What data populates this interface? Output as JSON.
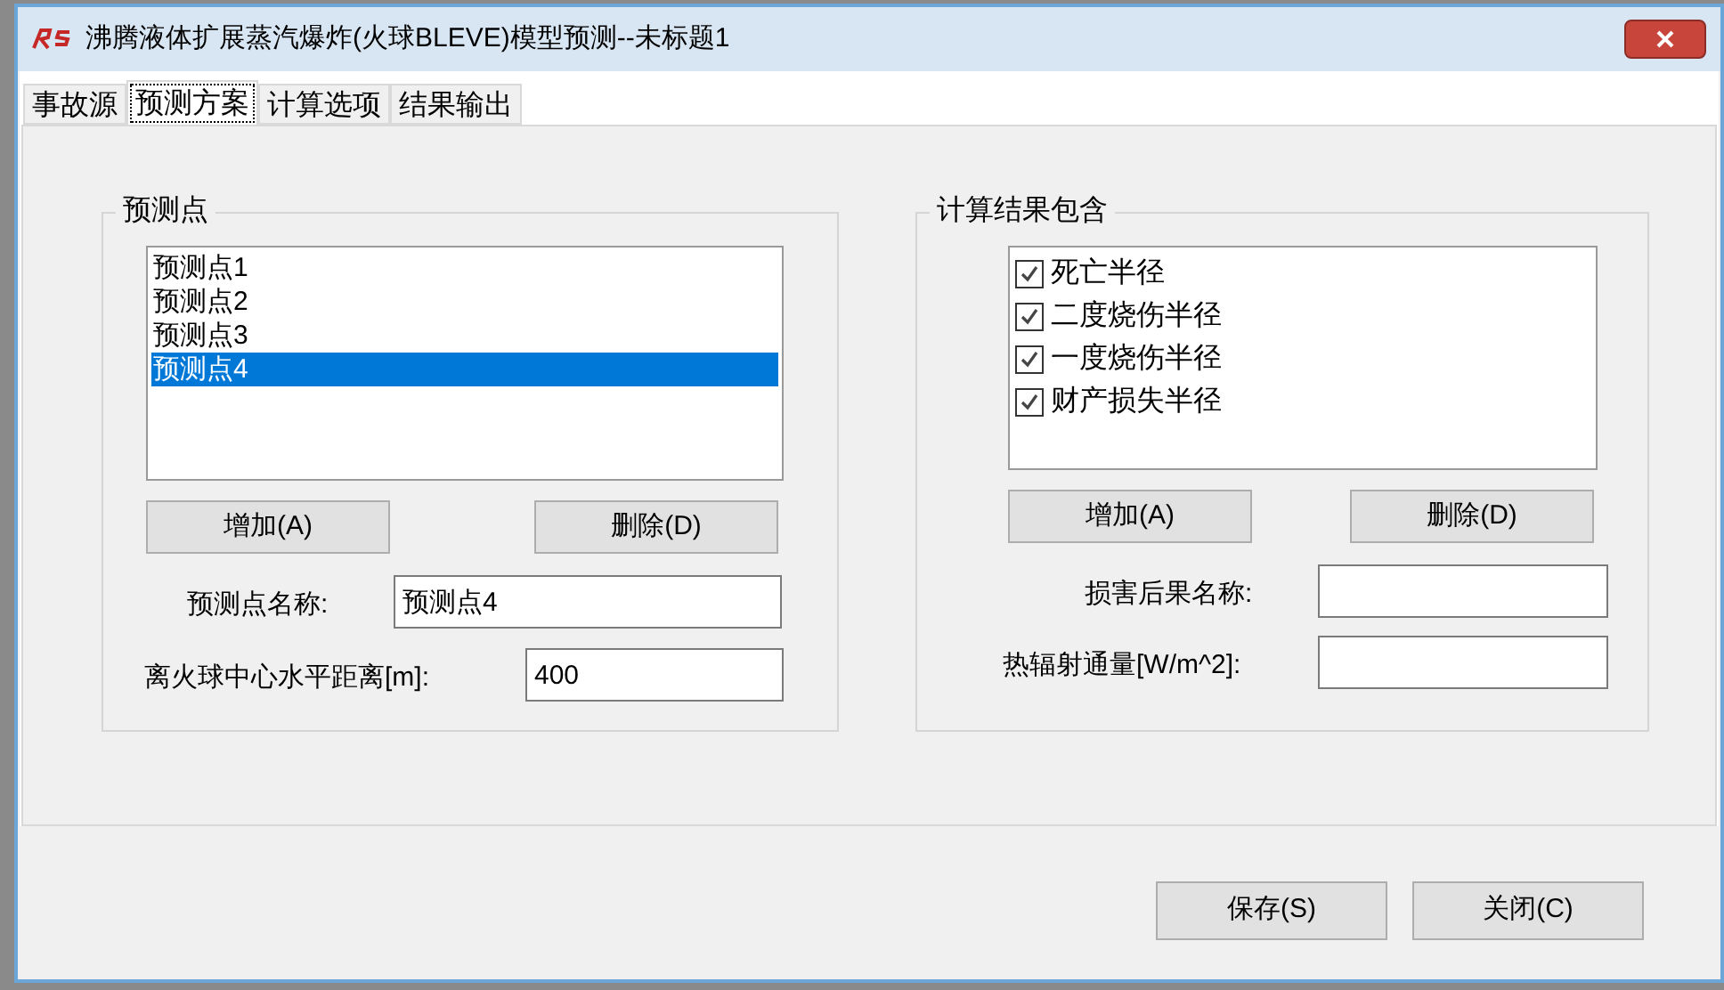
{
  "window": {
    "title": "沸腾液体扩展蒸汽爆炸(火球BLEVE)模型预测--未标题1"
  },
  "tabs": [
    {
      "label": "事故源",
      "selected": false
    },
    {
      "label": "预测方案",
      "selected": true
    },
    {
      "label": "计算选项",
      "selected": false
    },
    {
      "label": "结果输出",
      "selected": false
    }
  ],
  "prediction_points": {
    "title": "预测点",
    "items": [
      {
        "label": "预测点1",
        "selected": false
      },
      {
        "label": "预测点2",
        "selected": false
      },
      {
        "label": "预测点3",
        "selected": false
      },
      {
        "label": "预测点4",
        "selected": true
      }
    ],
    "buttons": [
      "增加(A)",
      "删除(D)"
    ],
    "fields": [
      {
        "label": "预测点名称:",
        "value": "预测点4"
      },
      {
        "label": "离火球中心水平距离[m]:",
        "value": "400"
      }
    ]
  },
  "results": {
    "title": "计算结果包含",
    "items": [
      {
        "label": "死亡半径",
        "checked": true
      },
      {
        "label": "二度烧伤半径",
        "checked": true
      },
      {
        "label": "一度烧伤半径",
        "checked": true
      },
      {
        "label": "财产损失半径",
        "checked": true
      }
    ],
    "buttons": [
      "增加(A)",
      "删除(D)"
    ],
    "fields": [
      {
        "label": "损害后果名称:"
      },
      {
        "label": "热辐射通量[W/m^2]:"
      }
    ]
  },
  "footer_buttons": [
    "保存(S)",
    "关闭(C)"
  ]
}
